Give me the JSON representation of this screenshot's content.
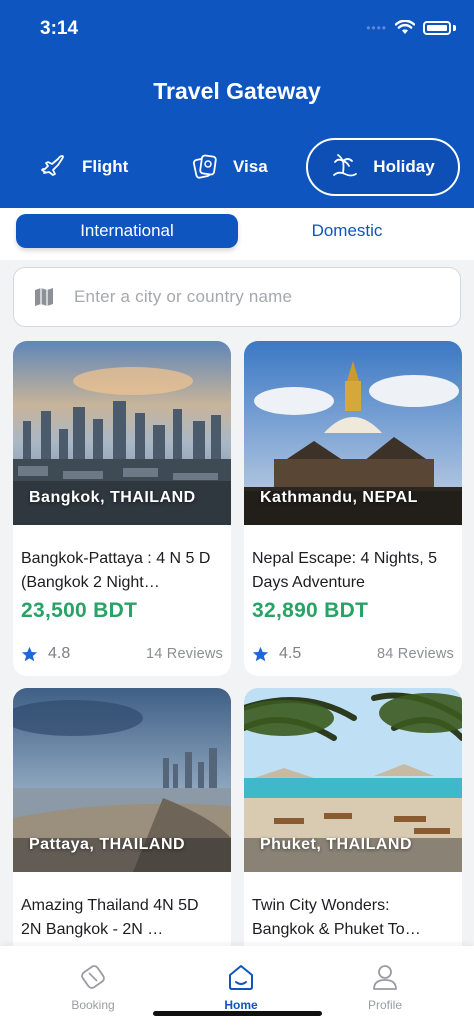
{
  "status_bar": {
    "time": "3:14"
  },
  "app": {
    "title": "Travel Gateway"
  },
  "categories": [
    {
      "label": "Flight",
      "icon": "airplane-icon",
      "active": false
    },
    {
      "label": "Visa",
      "icon": "passport-icon",
      "active": false
    },
    {
      "label": "Holiday",
      "icon": "island-icon",
      "active": true
    }
  ],
  "segments": {
    "international": "International",
    "domestic": "Domestic",
    "selected": "International"
  },
  "search": {
    "placeholder": "Enter a city or country name",
    "icon": "map-icon"
  },
  "packages": [
    {
      "location": "Bangkok, THAILAND",
      "title": "Bangkok-Pattaya : 4 N 5 D  (Bangkok 2 Night…",
      "price": "23,500 BDT",
      "rating": "4.8",
      "reviews": "14 Reviews"
    },
    {
      "location": "Kathmandu, NEPAL",
      "title": "Nepal Escape: 4 Nights, 5 Days Adventure",
      "price": "32,890 BDT",
      "rating": "4.5",
      "reviews": "84 Reviews"
    },
    {
      "location": "Pattaya, THAILAND",
      "title": "Amazing Thailand 4N 5D  2N Bangkok - 2N …",
      "price": "",
      "rating": "",
      "reviews": ""
    },
    {
      "location": "Phuket, THAILAND",
      "title": "Twin City Wonders: Bangkok & Phuket To…",
      "price": "",
      "rating": "",
      "reviews": ""
    }
  ],
  "tabbar": {
    "items": [
      {
        "label": "Booking",
        "icon": "booking-icon"
      },
      {
        "label": "Home",
        "icon": "home-icon"
      },
      {
        "label": "Profile",
        "icon": "profile-icon"
      }
    ],
    "active": "Home"
  },
  "colors": {
    "brand": "#0f55c0",
    "price": "#27a366",
    "star": "#1f66d6"
  }
}
